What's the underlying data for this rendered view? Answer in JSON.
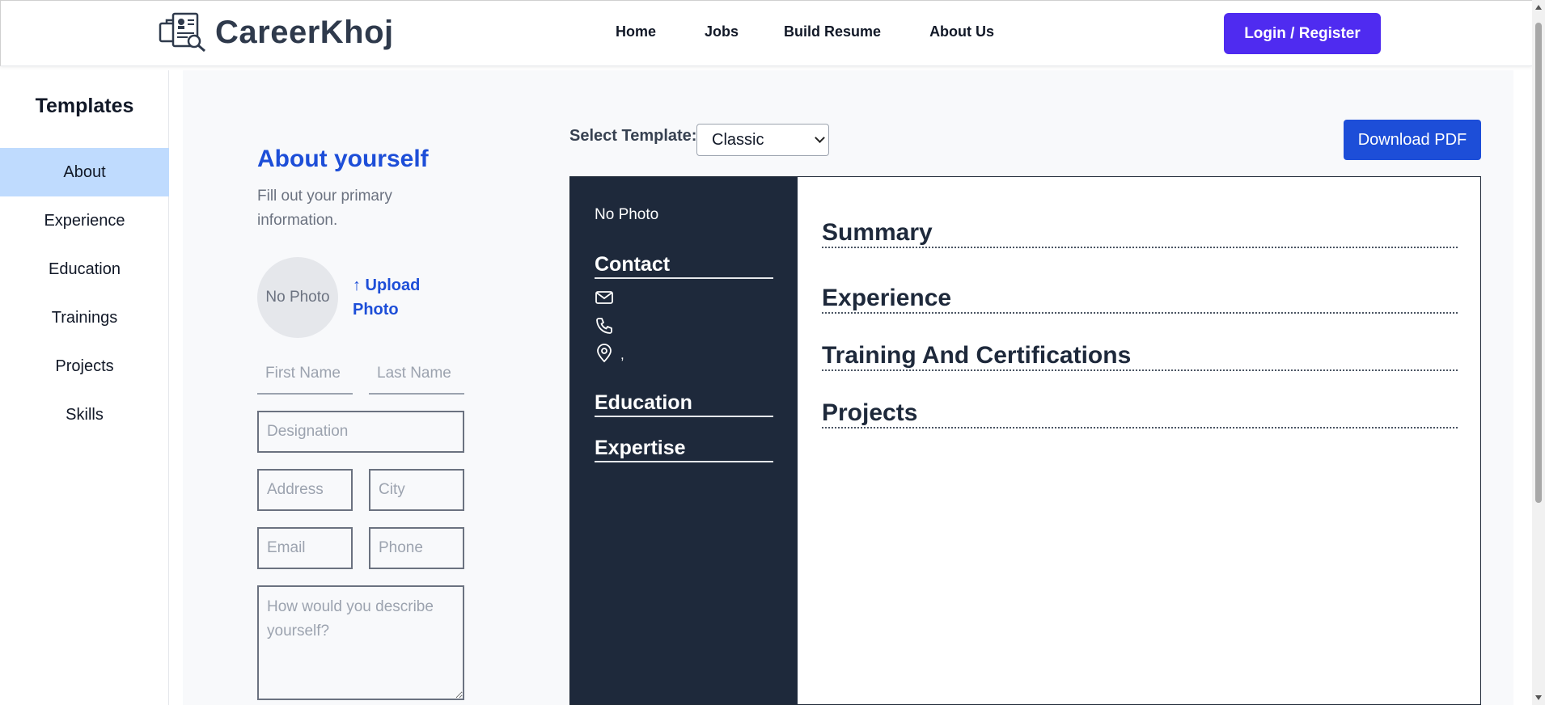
{
  "header": {
    "brand": "CareerKhoj",
    "nav": [
      "Home",
      "Jobs",
      "Build Resume",
      "About Us"
    ],
    "login_label": "Login / Register"
  },
  "sidebar": {
    "title": "Templates",
    "items": [
      {
        "label": "About",
        "active": true
      },
      {
        "label": "Experience"
      },
      {
        "label": "Education"
      },
      {
        "label": "Trainings"
      },
      {
        "label": "Projects"
      },
      {
        "label": "Skills"
      }
    ]
  },
  "form": {
    "title": "About yourself",
    "subtitle": "Fill out your primary information.",
    "photo_placeholder": "No Photo",
    "upload_label": "↑ Upload Photo",
    "first_name_placeholder": "First Name",
    "last_name_placeholder": "Last Name",
    "designation_placeholder": "Designation",
    "address_placeholder": "Address",
    "city_placeholder": "City",
    "email_placeholder": "Email",
    "phone_placeholder": "Phone",
    "description_placeholder": "How would you describe yourself?"
  },
  "toolbar": {
    "select_label": "Select Template:",
    "selected_template": "Classic",
    "download_label": "Download PDF"
  },
  "resume": {
    "left": {
      "photo": "No Photo",
      "contact_heading": "Contact",
      "location_text": ",",
      "education_heading": "Education",
      "expertise_heading": "Expertise"
    },
    "right": {
      "sections": [
        "Summary",
        "Experience",
        "Training And Certifications",
        "Projects"
      ]
    }
  },
  "colors": {
    "accent": "#1d4ed8",
    "login_button": "#4f2bf0",
    "sidebar_active": "#bfdbfe",
    "resume_dark": "#1e293b"
  }
}
